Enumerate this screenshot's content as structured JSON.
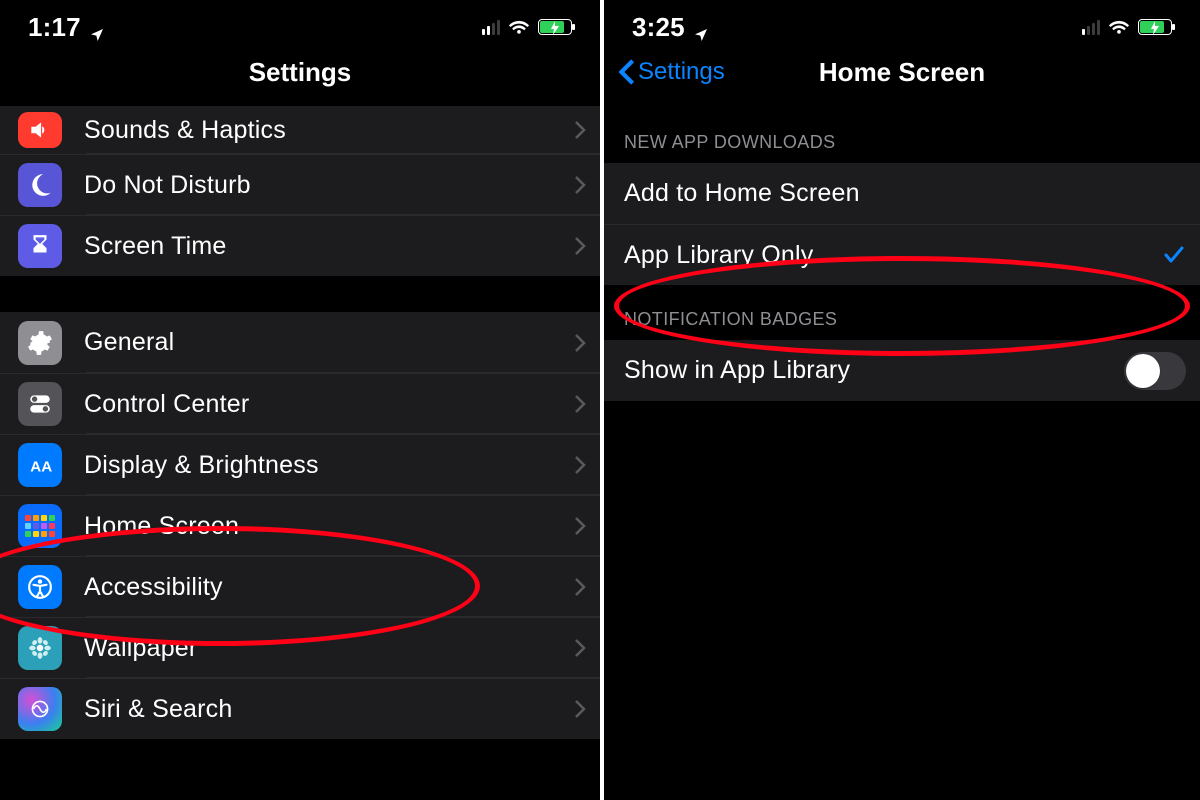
{
  "left": {
    "status": {
      "time": "1:17",
      "cell_active_bars": 2,
      "battery_percent": 75,
      "charging": true
    },
    "title": "Settings",
    "groups": [
      {
        "items": [
          {
            "id": "sounds",
            "label": "Sounds & Haptics",
            "icon": "speaker-icon",
            "icon_bg": "bg-red"
          },
          {
            "id": "dnd",
            "label": "Do Not Disturb",
            "icon": "moon-icon",
            "icon_bg": "bg-purple"
          },
          {
            "id": "screentime",
            "label": "Screen Time",
            "icon": "hourglass-icon",
            "icon_bg": "bg-indigo"
          }
        ]
      },
      {
        "items": [
          {
            "id": "general",
            "label": "General",
            "icon": "gear-icon",
            "icon_bg": "bg-gray"
          },
          {
            "id": "controlcenter",
            "label": "Control Center",
            "icon": "switches-icon",
            "icon_bg": "bg-gray2"
          },
          {
            "id": "display",
            "label": "Display & Brightness",
            "icon": "aa-icon",
            "icon_bg": "bg-blue"
          },
          {
            "id": "homescreen",
            "label": "Home Screen",
            "icon": "home-grid-icon",
            "icon_bg": "bg-blue2"
          },
          {
            "id": "accessibility",
            "label": "Accessibility",
            "icon": "accessibility-icon",
            "icon_bg": "bg-blue"
          },
          {
            "id": "wallpaper",
            "label": "Wallpaper",
            "icon": "flower-icon",
            "icon_bg": "bg-wall"
          },
          {
            "id": "siri",
            "label": "Siri & Search",
            "icon": "siri-icon",
            "icon_bg": "bg-siri"
          }
        ]
      }
    ],
    "annotation": {
      "target": "homescreen"
    }
  },
  "right": {
    "status": {
      "time": "3:25",
      "cell_active_bars": 1,
      "battery_percent": 75,
      "charging": true
    },
    "back_label": "Settings",
    "title": "Home Screen",
    "sections": [
      {
        "header": "NEW APP DOWNLOADS",
        "rows": [
          {
            "id": "addhome",
            "label": "Add to Home Screen",
            "selected": false
          },
          {
            "id": "applib",
            "label": "App Library Only",
            "selected": true
          }
        ]
      },
      {
        "header": "NOTIFICATION BADGES",
        "rows": [
          {
            "id": "showapplib",
            "label": "Show in App Library",
            "toggle": false
          }
        ]
      }
    ],
    "annotation": {
      "target": "applib"
    }
  },
  "colors": {
    "accent": "#0b84ff",
    "annotation": "#ff0016",
    "battery_fill": "#30d158"
  }
}
